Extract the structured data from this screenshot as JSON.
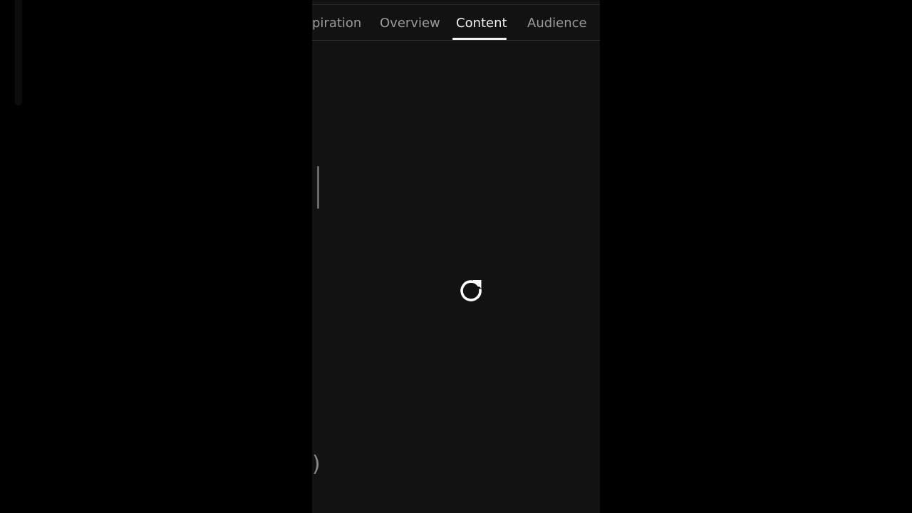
{
  "tabs": [
    {
      "label": "piration",
      "active": false
    },
    {
      "label": "Overview",
      "active": false
    },
    {
      "label": "Content",
      "active": true
    },
    {
      "label": "Audience",
      "active": false
    }
  ],
  "content": {
    "loading_icon": "refresh-icon",
    "edge_fragment": ")"
  },
  "colors": {
    "background": "#000000",
    "panel": "#121212",
    "tab_inactive": "#9a9a9a",
    "tab_active": "#f2f2f2"
  }
}
